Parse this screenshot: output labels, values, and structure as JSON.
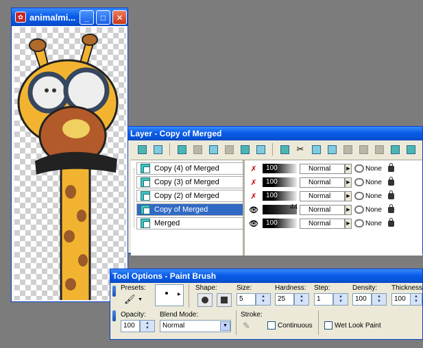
{
  "image_window": {
    "title": "animalmi..."
  },
  "layer_palette": {
    "title": "Layer - Copy of Merged",
    "layers": [
      {
        "name": "Copy (4) of Merged",
        "opacity": "100",
        "blend": "Normal",
        "mask": "None",
        "visible": false,
        "selected": false
      },
      {
        "name": "Copy (3) of Merged",
        "opacity": "100",
        "blend": "Normal",
        "mask": "None",
        "visible": false,
        "selected": false
      },
      {
        "name": "Copy (2) of Merged",
        "opacity": "100",
        "blend": "Normal",
        "mask": "None",
        "visible": false,
        "selected": false
      },
      {
        "name": "Copy of Merged",
        "opacity": "44",
        "blend": "Normal",
        "mask": "None",
        "visible": true,
        "selected": true
      },
      {
        "name": "Merged",
        "opacity": "100",
        "blend": "Normal",
        "mask": "None",
        "visible": true,
        "selected": false
      }
    ]
  },
  "tool_options": {
    "title": "Tool Options - Paint Brush",
    "presets_label": "Presets:",
    "shape_label": "Shape:",
    "size_label": "Size:",
    "size_value": "5",
    "hardness_label": "Hardness:",
    "hardness_value": "25",
    "step_label": "Step:",
    "step_value": "1",
    "density_label": "Density:",
    "density_value": "100",
    "thickness_label": "Thickness:",
    "thickness_value": "100",
    "opacity_label": "Opacity:",
    "opacity_value": "100",
    "blend_mode_label": "Blend Mode:",
    "blend_mode_value": "Normal",
    "stroke_label": "Stroke:",
    "continuous_label": "Continuous",
    "wet_look_label": "Wet Look Paint"
  },
  "colors": {
    "titlebar": "#0a5ce8",
    "panel_bg": "#ece9d8",
    "selection": "#316ac5",
    "desktop": "#7c7c7c"
  }
}
